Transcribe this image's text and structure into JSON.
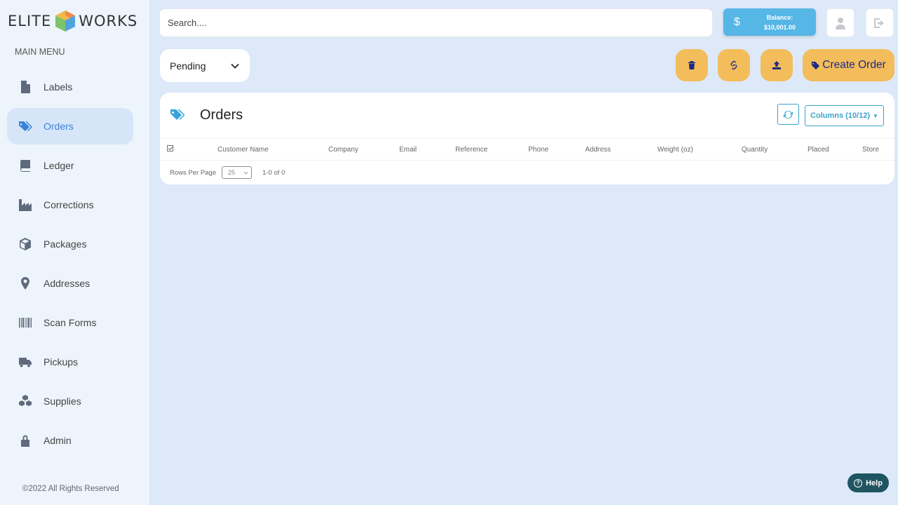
{
  "logo": {
    "left": "ELITE",
    "right": "WORKS"
  },
  "sidebar": {
    "heading": "MAIN MENU",
    "items": [
      {
        "label": "Labels",
        "icon": "file-icon"
      },
      {
        "label": "Orders",
        "icon": "tags-icon",
        "active": true
      },
      {
        "label": "Ledger",
        "icon": "book-icon"
      },
      {
        "label": "Corrections",
        "icon": "industry-icon"
      },
      {
        "label": "Packages",
        "icon": "cube-icon"
      },
      {
        "label": "Addresses",
        "icon": "map-marker-icon"
      },
      {
        "label": "Scan Forms",
        "icon": "barcode-icon"
      },
      {
        "label": "Pickups",
        "icon": "truck-icon"
      },
      {
        "label": "Supplies",
        "icon": "cubes-icon"
      },
      {
        "label": "Admin",
        "icon": "lock-icon"
      }
    ],
    "copyright": "©2022 All Rights Reserved"
  },
  "search": {
    "placeholder": "Search...."
  },
  "balance": {
    "symbol": "$",
    "label": "Balance:",
    "amount": "$10,001.00"
  },
  "status_filter": {
    "selected": "Pending"
  },
  "toolbar": {
    "create_label": "Create Order"
  },
  "panel": {
    "title": "Orders",
    "columns_label": "Columns (10/12)",
    "headers": [
      "Customer Name",
      "Company",
      "Email",
      "Reference",
      "Phone",
      "Address",
      "Weight (oz)",
      "Quantity",
      "Placed",
      "Store"
    ],
    "rows_per_page_label": "Rows Per Page",
    "rows_per_page": "25",
    "range": "1-0 of 0"
  },
  "help": {
    "label": "Help"
  },
  "colors": {
    "accent": "#3a84d8",
    "action": "#f3bd5c",
    "balance": "#56b6e5",
    "help": "#1f5561"
  }
}
